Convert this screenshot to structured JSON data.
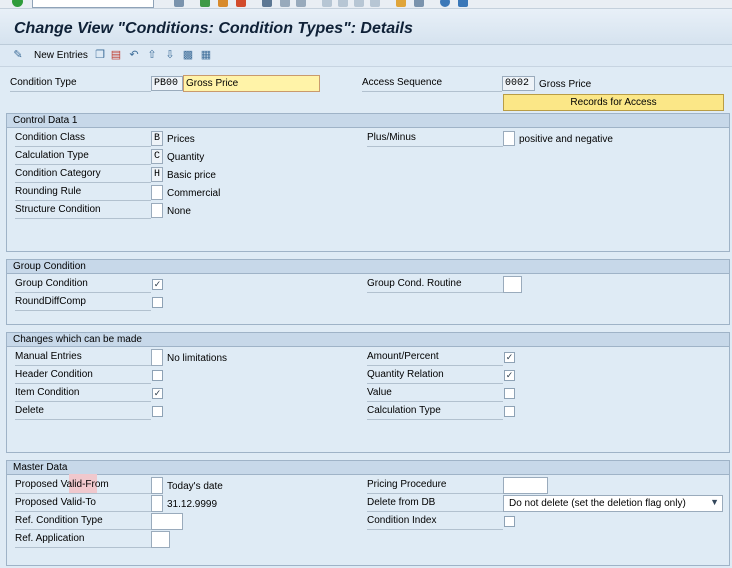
{
  "title": "Change View \"Conditions: Condition Types\": Details",
  "toolbar": {
    "new_entries_label": "New Entries"
  },
  "header": {
    "condition_type": {
      "label": "Condition Type",
      "code": "PB00",
      "name": "Gross Price"
    },
    "access_sequence": {
      "label": "Access Sequence",
      "code": "0002",
      "name": "Gross Price"
    },
    "records_button": "Records for Access"
  },
  "control_data": {
    "title": "Control Data 1",
    "condition_class": {
      "label": "Condition Class",
      "code": "B",
      "text": "Prices"
    },
    "calculation_type": {
      "label": "Calculation Type",
      "code": "C",
      "text": "Quantity"
    },
    "condition_category": {
      "label": "Condition Category",
      "code": "H",
      "text": "Basic price"
    },
    "rounding_rule": {
      "label": "Rounding Rule",
      "code": "",
      "text": "Commercial"
    },
    "structure_condition": {
      "label": "Structure Condition",
      "code": "",
      "text": "None"
    },
    "plus_minus": {
      "label": "Plus/Minus",
      "code": "",
      "text": "positive and negative"
    }
  },
  "group_condition": {
    "title": "Group Condition",
    "group_condition": {
      "label": "Group Condition",
      "checked": true
    },
    "round_diff_comp": {
      "label": "RoundDiffComp",
      "checked": false
    },
    "group_cond_routine": {
      "label": "Group Cond. Routine",
      "value": ""
    }
  },
  "changes": {
    "title": "Changes which can be made",
    "manual_entries": {
      "label": "Manual Entries",
      "code": "",
      "text": "No limitations"
    },
    "header_condition": {
      "label": "Header Condition",
      "checked": false
    },
    "item_condition": {
      "label": "Item Condition",
      "checked": true
    },
    "delete": {
      "label": "Delete",
      "checked": false
    },
    "amount_percent": {
      "label": "Amount/Percent",
      "checked": true
    },
    "quantity_relation": {
      "label": "Quantity Relation",
      "checked": true
    },
    "value": {
      "label": "Value",
      "checked": false
    },
    "calculation_type": {
      "label": "Calculation Type",
      "checked": false
    }
  },
  "master_data": {
    "title": "Master Data",
    "proposed_valid_from": {
      "label": "Proposed Valid-From",
      "code": "",
      "text": "Today's date"
    },
    "proposed_valid_to": {
      "label": "Proposed Valid-To",
      "code": "",
      "text": "31.12.9999"
    },
    "ref_condition_type": {
      "label": "Ref. Condition Type",
      "value": ""
    },
    "ref_application": {
      "label": "Ref. Application",
      "value": ""
    },
    "pricing_procedure": {
      "label": "Pricing Procedure",
      "value": ""
    },
    "delete_from_db": {
      "label": "Delete from DB",
      "selected": "Do not delete (set the deletion flag only)"
    },
    "condition_index": {
      "label": "Condition Index",
      "checked": false
    }
  },
  "colors": {
    "accent_yellow": "#fff3a8",
    "panel_bg": "#dfebf5",
    "section_header": "#c7d8e9"
  }
}
